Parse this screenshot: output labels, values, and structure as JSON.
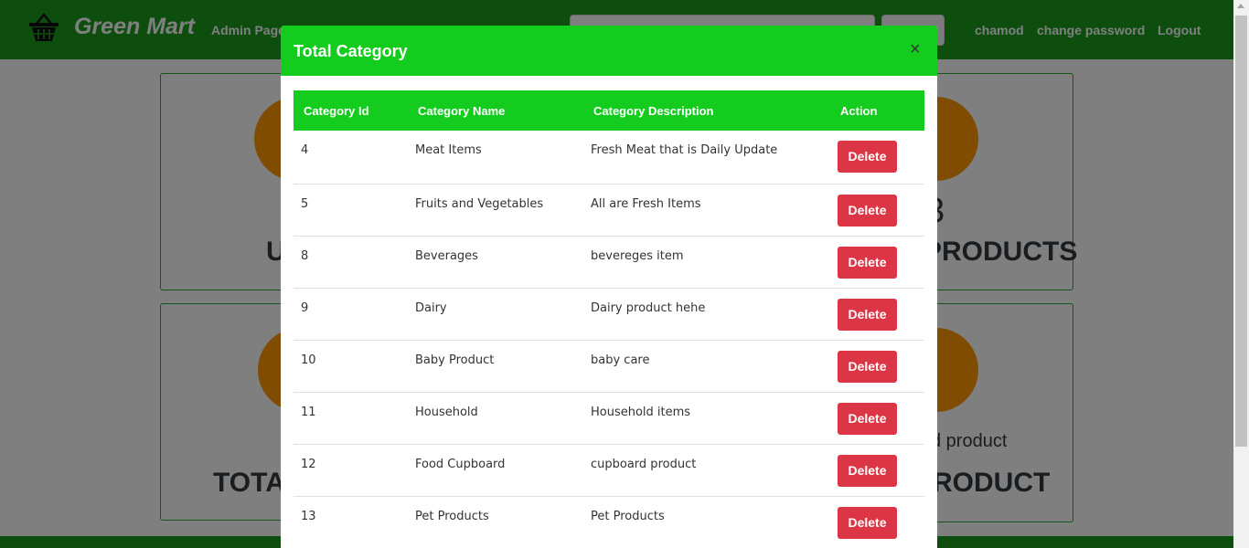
{
  "navbar": {
    "brand": "Green Mart",
    "admin_link": "Admin Page",
    "user_link": "chamod",
    "change_password_link": "change password",
    "logout_link": "Logout"
  },
  "dashboard": {
    "card1_text": "U",
    "card2_number": "3",
    "card2_text": "PRODUCTS",
    "card3_text": "TOTAL",
    "card4_subtext": "d product",
    "card4_text": "RODUCT"
  },
  "modal": {
    "title": "Total Category",
    "close_symbol": "×",
    "columns": [
      "Category Id",
      "Category Name",
      "Category Description",
      "Action"
    ],
    "rows": [
      {
        "id": "4",
        "name": "Meat Items",
        "description": "Fresh Meat that is Daily Update",
        "action": "Delete"
      },
      {
        "id": "5",
        "name": "Fruits and Vegetables",
        "description": "All are Fresh Items",
        "action": "Delete"
      },
      {
        "id": "8",
        "name": "Beverages",
        "description": "bevereges item",
        "action": "Delete"
      },
      {
        "id": "9",
        "name": "Dairy",
        "description": "Dairy product hehe",
        "action": "Delete"
      },
      {
        "id": "10",
        "name": "Baby Product",
        "description": "baby care",
        "action": "Delete"
      },
      {
        "id": "11",
        "name": "Household",
        "description": "Household items",
        "action": "Delete"
      },
      {
        "id": "12",
        "name": "Food Cupboard",
        "description": "cupboard product",
        "action": "Delete"
      },
      {
        "id": "13",
        "name": "Pet Products",
        "description": "Pet Products",
        "action": "Delete"
      }
    ]
  },
  "colors": {
    "navbar": "#1a9a1a",
    "modal_header": "#13cc1e",
    "delete_button": "#dc3545",
    "icon_circle": "#ff9800"
  },
  "icons": [
    "basket-icon",
    "close-icon",
    "user-icon",
    "cart-icon",
    "tag-icon"
  ]
}
